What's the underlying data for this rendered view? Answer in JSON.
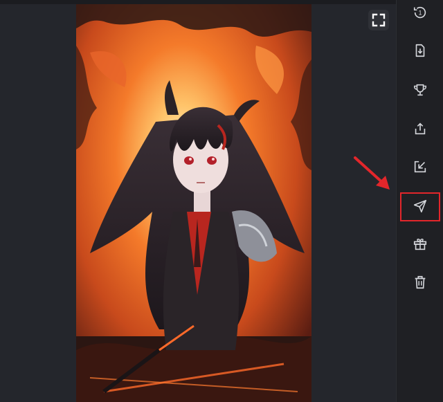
{
  "image": {
    "alt_icon": "anime-character-artwork"
  },
  "viewer": {
    "fullscreen_icon": "fullscreen-icon"
  },
  "toolbar": {
    "items": [
      {
        "icon": "history-one-icon",
        "badge": "1"
      },
      {
        "icon": "download-icon"
      },
      {
        "icon": "trophy-icon"
      },
      {
        "icon": "share-icon"
      },
      {
        "icon": "open-external-icon"
      },
      {
        "icon": "send-icon"
      },
      {
        "icon": "gift-icon"
      },
      {
        "icon": "trash-icon"
      }
    ]
  },
  "annotation": {
    "highlight_color": "#e3262b",
    "arrow_color": "#e3262b"
  },
  "colors": {
    "background": "#1f2024",
    "icon": "#d4d6db"
  }
}
